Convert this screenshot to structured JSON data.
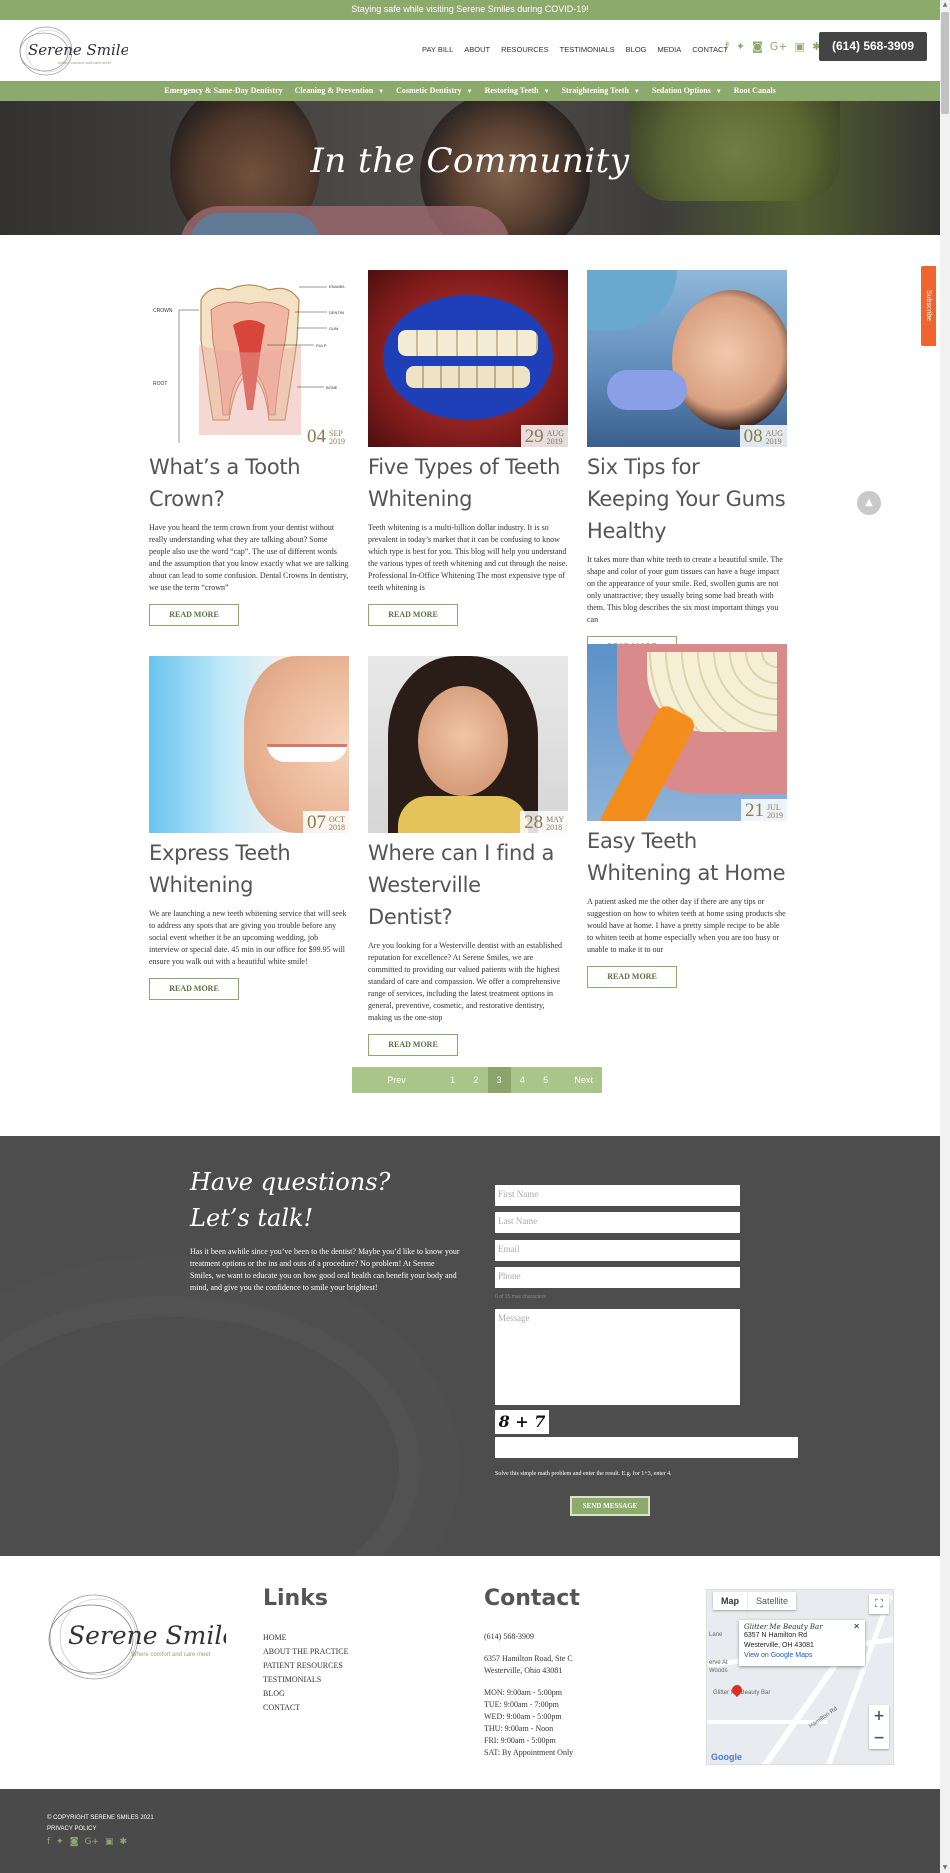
{
  "topbar": {
    "text": "Staying safe while visiting Serene Smiles during COVID-19!"
  },
  "header": {
    "logo_text": "Serene Smiles",
    "logo_tagline": "Where comfort and care meet",
    "nav": [
      "PAY BILL",
      "ABOUT",
      "RESOURCES",
      "TESTIMONIALS",
      "BLOG",
      "MEDIA",
      "CONTACT"
    ],
    "social_icons": [
      "facebook-icon",
      "twitter-icon",
      "instagram-icon",
      "google-plus-icon",
      "youtube-icon",
      "yelp-icon"
    ],
    "phone": "(614) 568-3909"
  },
  "mainnav": [
    {
      "label": "Emergency & Same-Day Dentistry",
      "dropdown": false
    },
    {
      "label": "Cleaning & Prevention",
      "dropdown": true
    },
    {
      "label": "Cosmetic Dentistry",
      "dropdown": true
    },
    {
      "label": "Restoring Teeth",
      "dropdown": true
    },
    {
      "label": "Straightening Teeth",
      "dropdown": true
    },
    {
      "label": "Sedation Options",
      "dropdown": true
    },
    {
      "label": "Root Canals",
      "dropdown": false
    }
  ],
  "hero": {
    "title": "In the Community"
  },
  "posts": [
    {
      "day": "04",
      "month": "SEP",
      "year": "2019",
      "title": "What’s a Tooth Crown?",
      "excerpt": "Have you heard the term crown from your dentist without really understanding what they are talking about?  Some people also use the word “cap”.  The use of different words and the assumption that you know exactly what we are talking about can lead to some confusion. Dental Crowns In dentistry, we use the term “crown”",
      "button": "READ MORE",
      "diagram_labels": [
        "CROWN",
        "ROOT",
        "ENAMEL",
        "DENTIN",
        "GUM",
        "PULP",
        "BONE"
      ]
    },
    {
      "day": "29",
      "month": "AUG",
      "year": "2019",
      "title": "Five Types of Teeth Whitening",
      "excerpt": "Teeth whitening is a multi-billion dollar industry.  It is so prevalent in today’s market that it can be confusing to know which type is best for you.  This blog will help you understand the various types of teeth whitening and cut through the noise. Professional In-Office Whitening The most expensive type of teeth whitening is",
      "button": "READ MORE"
    },
    {
      "day": "08",
      "month": "AUG",
      "year": "2019",
      "title": "Six Tips for Keeping Your Gums Healthy",
      "excerpt": "It takes more than white teeth to create a beautiful smile.  The shape and color of your gum tissues can have a huge impact on the appearance of your smile. Red, swollen gums are not only unattractive; they usually bring some bad breath with them.  This blog describes the six most important things you can",
      "button": "READ MORE"
    },
    {
      "day": "07",
      "month": "OCT",
      "year": "2018",
      "title": "Express Teeth Whitening",
      "excerpt": "We are launching a new teeth whitening service that will seek to address any spots that are giving you trouble before any social event whether it be an upcoming wedding, job interview or special date. 45 min in our office for $99.95 will ensure you walk out with a beautiful white smile!",
      "button": "READ MORE"
    },
    {
      "day": "28",
      "month": "MAY",
      "year": "2018",
      "title": "Where can I find a Westerville Dentist?",
      "excerpt": "Are you looking for a Westerville dentist with an established reputation for excellence? At Serene Smiles, we are committed to providing our valued patients with the highest standard of care and compassion. We offer a comprehensive range of services, including the latest treatment options in general, preventive, cosmetic, and restorative dentistry, making us the one-stop",
      "button": "READ MORE"
    },
    {
      "day": "21",
      "month": "JUL",
      "year": "2019",
      "title": "Easy Teeth Whitening at Home",
      "excerpt": "A patient asked me the other day if there are any tips or suggestion on how to whiten teeth at home using products she would have at home. I have a pretty simple recipe to be able to whiten teeth at home especially when you are too busy or unable to make it to our",
      "button": "READ MORE"
    }
  ],
  "pagination": {
    "prev": "Prev",
    "pages": [
      "1",
      "2",
      "3",
      "4",
      "5"
    ],
    "current": "3",
    "next": "Next"
  },
  "contact_form": {
    "heading": "Have questions? Let’s talk!",
    "text": "Has it been awhile since you’ve been to the dentist? Maybe you’d like to know your treatment options or the ins and outs of a procedure? No problem! At Serene Smiles, we want to educate you on how good oral health can benefit your body and mind, and give you the confidence to smile your brightest!",
    "first_name": "First Name",
    "last_name": "Last Name",
    "email": "Email",
    "phone": "Phone",
    "char_count": "0 of 15 max characters",
    "message": "Message",
    "captcha": "8 + 7",
    "hint": "Solve this simple math problem and enter the result. E.g. for 1+3, enter 4.",
    "send": "SEND MESSAGE"
  },
  "footer": {
    "links_heading": "Links",
    "links": [
      "HOME",
      "ABOUT THE PRACTICE",
      "PATIENT RESOURCES",
      "TESTIMONIALS",
      "BLOG",
      "CONTACT"
    ],
    "contact_heading": "Contact",
    "phone": "(614) 568-3909",
    "address1": "6357 Hamilton Road, Ste C",
    "address2": "Westerville, Ohio 43081",
    "hours": [
      "MON: 9:00am - 5:00pm",
      "TUE: 9:00am - 7:00pm",
      "WED: 9:00am - 5:00pm",
      "THU: 9:00am - Noon",
      "FRI: 9:00am - 5:00pm",
      "SAT: By Appointment Only"
    ],
    "map": {
      "tab_map": "Map",
      "tab_satellite": "Satellite",
      "place_name": "Glitter Me Beauty Bar",
      "place_addr1": "6357 N Hamilton Rd",
      "place_addr2": "Westerville, OH 43081",
      "place_link": "View on Google Maps",
      "street_labels": [
        "Lane",
        "erve At",
        "Woods",
        "Glitter Me Beauty Bar",
        "Hamilton Rd"
      ],
      "google": "Google"
    },
    "copyright": "© COPYRIGHT SERENE SMILES 2021",
    "privacy": "PRIVACY POLICY"
  },
  "widgets": {
    "subscribe": "Subscribe",
    "to_top": "▲"
  },
  "colors": {
    "brand_green": "#8daa6d",
    "dark": "#4d4d4d",
    "subscribe": "#f0642d"
  }
}
